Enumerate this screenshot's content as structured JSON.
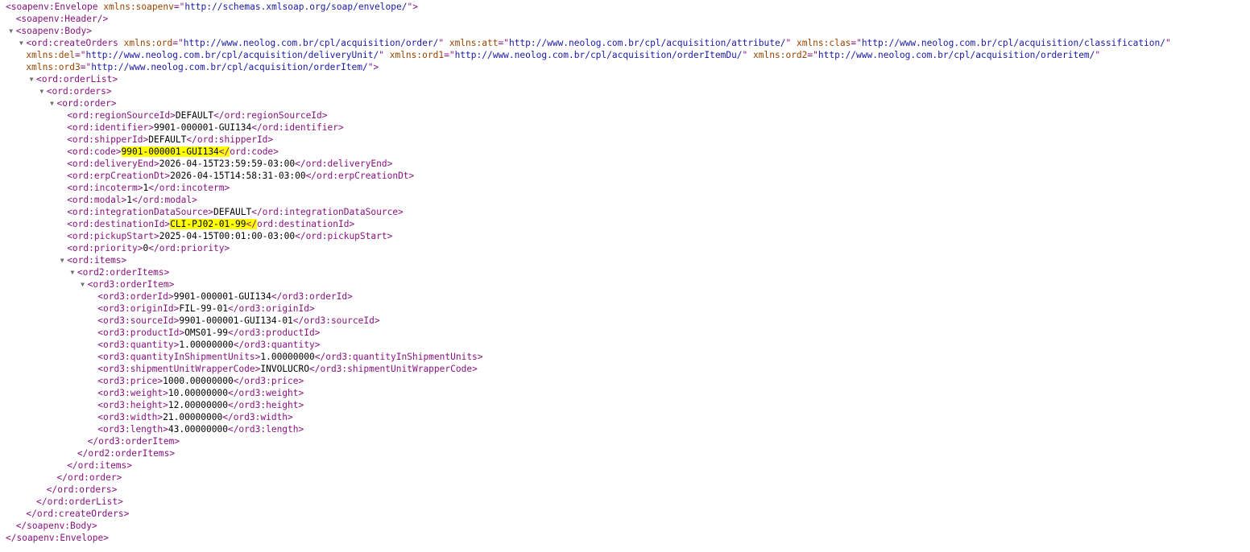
{
  "colors": {
    "tag": "#881280",
    "attribute_name": "#994500",
    "attribute_value": "#1a1aa6",
    "text": "#000000",
    "highlight": "#ffff00",
    "toggle": "#6e6e6e"
  },
  "toggle_icon": "triangle-down-icon",
  "lines": [
    {
      "indent": 0,
      "toggle": false,
      "segs": [
        {
          "t": "tag",
          "v": "<soapenv:Envelope"
        },
        {
          "t": "text",
          "v": " "
        },
        {
          "t": "attr-name",
          "v": "xmlns:soapenv"
        },
        {
          "t": "tag",
          "v": "=\""
        },
        {
          "t": "attr-value",
          "v": "http://schemas.xmlsoap.org/soap/envelope/"
        },
        {
          "t": "tag",
          "v": "\">"
        }
      ]
    },
    {
      "indent": 1,
      "toggle": false,
      "segs": [
        {
          "t": "tag",
          "v": "<soapenv:Header/>"
        }
      ]
    },
    {
      "indent": 1,
      "toggle": true,
      "segs": [
        {
          "t": "tag",
          "v": "<soapenv:Body>"
        }
      ]
    },
    {
      "indent": 2,
      "toggle": true,
      "segs": [
        {
          "t": "tag",
          "v": "<ord:createOrders"
        },
        {
          "t": "text",
          "v": " "
        },
        {
          "t": "attr-name",
          "v": "xmlns:ord"
        },
        {
          "t": "tag",
          "v": "=\""
        },
        {
          "t": "attr-value",
          "v": "http://www.neolog.com.br/cpl/acquisition/order/"
        },
        {
          "t": "tag",
          "v": "\""
        },
        {
          "t": "text",
          "v": " "
        },
        {
          "t": "attr-name",
          "v": "xmlns:att"
        },
        {
          "t": "tag",
          "v": "=\""
        },
        {
          "t": "attr-value",
          "v": "http://www.neolog.com.br/cpl/acquisition/attribute/"
        },
        {
          "t": "tag",
          "v": "\""
        },
        {
          "t": "text",
          "v": " "
        },
        {
          "t": "attr-name",
          "v": "xmlns:clas"
        },
        {
          "t": "tag",
          "v": "=\""
        },
        {
          "t": "attr-value",
          "v": "http://www.neolog.com.br/cpl/acquisition/classification/"
        },
        {
          "t": "tag",
          "v": "\""
        }
      ]
    },
    {
      "indent": 2,
      "toggle": false,
      "segs": [
        {
          "t": "attr-name",
          "v": "xmlns:del"
        },
        {
          "t": "tag",
          "v": "=\""
        },
        {
          "t": "attr-value",
          "v": "http://www.neolog.com.br/cpl/acquisition/deliveryUnit/"
        },
        {
          "t": "tag",
          "v": "\""
        },
        {
          "t": "text",
          "v": " "
        },
        {
          "t": "attr-name",
          "v": "xmlns:ord1"
        },
        {
          "t": "tag",
          "v": "=\""
        },
        {
          "t": "attr-value",
          "v": "http://www.neolog.com.br/cpl/acquisition/orderItemDu/"
        },
        {
          "t": "tag",
          "v": "\""
        },
        {
          "t": "text",
          "v": " "
        },
        {
          "t": "attr-name",
          "v": "xmlns:ord2"
        },
        {
          "t": "tag",
          "v": "=\""
        },
        {
          "t": "attr-value",
          "v": "http://www.neolog.com.br/cpl/acquisition/orderitem/"
        },
        {
          "t": "tag",
          "v": "\""
        }
      ]
    },
    {
      "indent": 2,
      "toggle": false,
      "segs": [
        {
          "t": "attr-name",
          "v": "xmlns:ord3"
        },
        {
          "t": "tag",
          "v": "=\""
        },
        {
          "t": "attr-value",
          "v": "http://www.neolog.com.br/cpl/acquisition/orderItem/"
        },
        {
          "t": "tag",
          "v": "\">"
        }
      ]
    },
    {
      "indent": 3,
      "toggle": true,
      "segs": [
        {
          "t": "tag",
          "v": "<ord:orderList>"
        }
      ]
    },
    {
      "indent": 4,
      "toggle": true,
      "segs": [
        {
          "t": "tag",
          "v": "<ord:orders>"
        }
      ]
    },
    {
      "indent": 5,
      "toggle": true,
      "segs": [
        {
          "t": "tag",
          "v": "<ord:order>"
        }
      ]
    },
    {
      "indent": 6,
      "toggle": false,
      "segs": [
        {
          "t": "tag",
          "v": "<ord:regionSourceId>"
        },
        {
          "t": "text",
          "v": "DEFAULT"
        },
        {
          "t": "tag",
          "v": "</ord:regionSourceId>"
        }
      ]
    },
    {
      "indent": 6,
      "toggle": false,
      "segs": [
        {
          "t": "tag",
          "v": "<ord:identifier>"
        },
        {
          "t": "text",
          "v": "9901-000001-GUI134"
        },
        {
          "t": "tag",
          "v": "</ord:identifier>"
        }
      ]
    },
    {
      "indent": 6,
      "toggle": false,
      "segs": [
        {
          "t": "tag",
          "v": "<ord:shipperId>"
        },
        {
          "t": "text",
          "v": "DEFAULT"
        },
        {
          "t": "tag",
          "v": "</ord:shipperId>"
        }
      ]
    },
    {
      "indent": 6,
      "toggle": false,
      "segs": [
        {
          "t": "tag",
          "v": "<ord:code>"
        },
        {
          "t": "text",
          "v": "9901-000001-GUI134",
          "hl": true
        },
        {
          "t": "tag",
          "v": "</",
          "hl": true
        },
        {
          "t": "tag",
          "v": "ord:code>"
        }
      ]
    },
    {
      "indent": 6,
      "toggle": false,
      "segs": [
        {
          "t": "tag",
          "v": "<ord:deliveryEnd>"
        },
        {
          "t": "text",
          "v": "2026-04-15T23:59:59-03:00"
        },
        {
          "t": "tag",
          "v": "</ord:deliveryEnd>"
        }
      ]
    },
    {
      "indent": 6,
      "toggle": false,
      "segs": [
        {
          "t": "tag",
          "v": "<ord:erpCreationDt>"
        },
        {
          "t": "text",
          "v": "2026-04-15T14:58:31-03:00"
        },
        {
          "t": "tag",
          "v": "</ord:erpCreationDt>"
        }
      ]
    },
    {
      "indent": 6,
      "toggle": false,
      "segs": [
        {
          "t": "tag",
          "v": "<ord:incoterm>"
        },
        {
          "t": "text",
          "v": "1"
        },
        {
          "t": "tag",
          "v": "</ord:incoterm>"
        }
      ]
    },
    {
      "indent": 6,
      "toggle": false,
      "segs": [
        {
          "t": "tag",
          "v": "<ord:modal>"
        },
        {
          "t": "text",
          "v": "1"
        },
        {
          "t": "tag",
          "v": "</ord:modal>"
        }
      ]
    },
    {
      "indent": 6,
      "toggle": false,
      "segs": [
        {
          "t": "tag",
          "v": "<ord:integrationDataSource>"
        },
        {
          "t": "text",
          "v": "DEFAULT"
        },
        {
          "t": "tag",
          "v": "</ord:integrationDataSource>"
        }
      ]
    },
    {
      "indent": 6,
      "toggle": false,
      "segs": [
        {
          "t": "tag",
          "v": "<ord:destinationId>"
        },
        {
          "t": "text",
          "v": "CLI-PJ02-01-99",
          "hl": true
        },
        {
          "t": "tag",
          "v": "</",
          "hl": true
        },
        {
          "t": "tag",
          "v": "ord:destinationId>"
        }
      ]
    },
    {
      "indent": 6,
      "toggle": false,
      "segs": [
        {
          "t": "tag",
          "v": "<ord:pickupStart>"
        },
        {
          "t": "text",
          "v": "2025-04-15T00:01:00-03:00"
        },
        {
          "t": "tag",
          "v": "</ord:pickupStart>"
        }
      ]
    },
    {
      "indent": 6,
      "toggle": false,
      "segs": [
        {
          "t": "tag",
          "v": "<ord:priority>"
        },
        {
          "t": "text",
          "v": "0"
        },
        {
          "t": "tag",
          "v": "</ord:priority>"
        }
      ]
    },
    {
      "indent": 6,
      "toggle": true,
      "segs": [
        {
          "t": "tag",
          "v": "<ord:items>"
        }
      ]
    },
    {
      "indent": 7,
      "toggle": true,
      "segs": [
        {
          "t": "tag",
          "v": "<ord2:orderItems>"
        }
      ]
    },
    {
      "indent": 8,
      "toggle": true,
      "segs": [
        {
          "t": "tag",
          "v": "<ord3:orderItem>"
        }
      ]
    },
    {
      "indent": 9,
      "toggle": false,
      "segs": [
        {
          "t": "tag",
          "v": "<ord3:orderId>"
        },
        {
          "t": "text",
          "v": "9901-000001-GUI134"
        },
        {
          "t": "tag",
          "v": "</ord3:orderId>"
        }
      ]
    },
    {
      "indent": 9,
      "toggle": false,
      "segs": [
        {
          "t": "tag",
          "v": "<ord3:originId>"
        },
        {
          "t": "text",
          "v": "FIL-99-01"
        },
        {
          "t": "tag",
          "v": "</ord3:originId>"
        }
      ]
    },
    {
      "indent": 9,
      "toggle": false,
      "segs": [
        {
          "t": "tag",
          "v": "<ord3:sourceId>"
        },
        {
          "t": "text",
          "v": "9901-000001-GUI134-01"
        },
        {
          "t": "tag",
          "v": "</ord3:sourceId>"
        }
      ]
    },
    {
      "indent": 9,
      "toggle": false,
      "segs": [
        {
          "t": "tag",
          "v": "<ord3:productId>"
        },
        {
          "t": "text",
          "v": "OMS01-99"
        },
        {
          "t": "tag",
          "v": "</ord3:productId>"
        }
      ]
    },
    {
      "indent": 9,
      "toggle": false,
      "segs": [
        {
          "t": "tag",
          "v": "<ord3:quantity>"
        },
        {
          "t": "text",
          "v": "1.00000000"
        },
        {
          "t": "tag",
          "v": "</ord3:quantity>"
        }
      ]
    },
    {
      "indent": 9,
      "toggle": false,
      "segs": [
        {
          "t": "tag",
          "v": "<ord3:quantityInShipmentUnits>"
        },
        {
          "t": "text",
          "v": "1.00000000"
        },
        {
          "t": "tag",
          "v": "</ord3:quantityInShipmentUnits>"
        }
      ]
    },
    {
      "indent": 9,
      "toggle": false,
      "segs": [
        {
          "t": "tag",
          "v": "<ord3:shipmentUnitWrapperCode>"
        },
        {
          "t": "text",
          "v": "INVOLUCRO"
        },
        {
          "t": "tag",
          "v": "</ord3:shipmentUnitWrapperCode>"
        }
      ]
    },
    {
      "indent": 9,
      "toggle": false,
      "segs": [
        {
          "t": "tag",
          "v": "<ord3:price>"
        },
        {
          "t": "text",
          "v": "1000.00000000"
        },
        {
          "t": "tag",
          "v": "</ord3:price>"
        }
      ]
    },
    {
      "indent": 9,
      "toggle": false,
      "segs": [
        {
          "t": "tag",
          "v": "<ord3:weight>"
        },
        {
          "t": "text",
          "v": "10.00000000"
        },
        {
          "t": "tag",
          "v": "</ord3:weight>"
        }
      ]
    },
    {
      "indent": 9,
      "toggle": false,
      "segs": [
        {
          "t": "tag",
          "v": "<ord3:height>"
        },
        {
          "t": "text",
          "v": "12.00000000"
        },
        {
          "t": "tag",
          "v": "</ord3:height>"
        }
      ]
    },
    {
      "indent": 9,
      "toggle": false,
      "segs": [
        {
          "t": "tag",
          "v": "<ord3:width>"
        },
        {
          "t": "text",
          "v": "21.00000000"
        },
        {
          "t": "tag",
          "v": "</ord3:width>"
        }
      ]
    },
    {
      "indent": 9,
      "toggle": false,
      "segs": [
        {
          "t": "tag",
          "v": "<ord3:length>"
        },
        {
          "t": "text",
          "v": "43.00000000"
        },
        {
          "t": "tag",
          "v": "</ord3:length>"
        }
      ]
    },
    {
      "indent": 8,
      "toggle": false,
      "segs": [
        {
          "t": "tag",
          "v": "</ord3:orderItem>"
        }
      ]
    },
    {
      "indent": 7,
      "toggle": false,
      "segs": [
        {
          "t": "tag",
          "v": "</ord2:orderItems>"
        }
      ]
    },
    {
      "indent": 6,
      "toggle": false,
      "segs": [
        {
          "t": "tag",
          "v": "</ord:items>"
        }
      ]
    },
    {
      "indent": 5,
      "toggle": false,
      "segs": [
        {
          "t": "tag",
          "v": "</ord:order>"
        }
      ]
    },
    {
      "indent": 4,
      "toggle": false,
      "segs": [
        {
          "t": "tag",
          "v": "</ord:orders>"
        }
      ]
    },
    {
      "indent": 3,
      "toggle": false,
      "segs": [
        {
          "t": "tag",
          "v": "</ord:orderList>"
        }
      ]
    },
    {
      "indent": 2,
      "toggle": false,
      "segs": [
        {
          "t": "tag",
          "v": "</ord:createOrders>"
        }
      ]
    },
    {
      "indent": 1,
      "toggle": false,
      "segs": [
        {
          "t": "tag",
          "v": "</soapenv:Body>"
        }
      ]
    },
    {
      "indent": 0,
      "toggle": false,
      "segs": [
        {
          "t": "tag",
          "v": "</soapenv:Envelope>"
        }
      ]
    }
  ]
}
